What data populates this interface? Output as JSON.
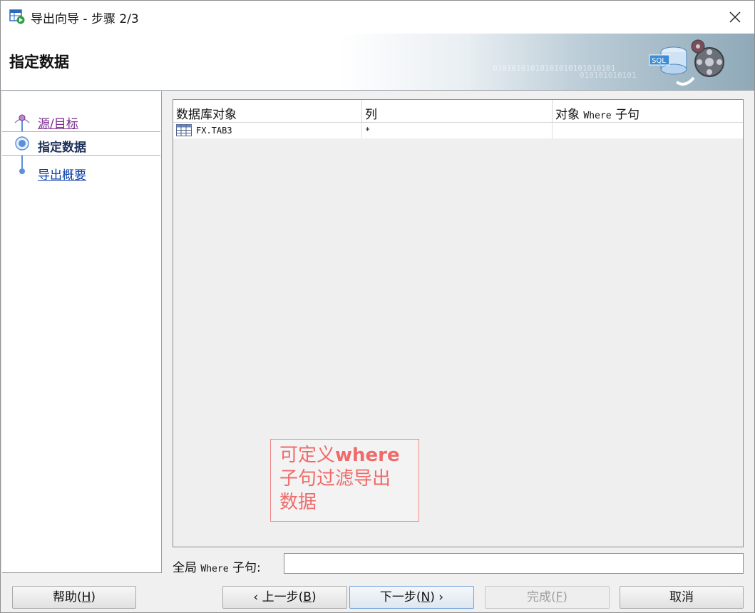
{
  "window": {
    "title": "导出向导 - 步骤 2/3"
  },
  "banner": {
    "title": "指定数据",
    "binary_line1": "01010101010101010101010101",
    "binary_line2": "010101010101"
  },
  "steps": [
    {
      "label": "源/目标",
      "state": "visited"
    },
    {
      "label": "指定数据",
      "state": "current"
    },
    {
      "label": "导出概要",
      "state": "pending"
    }
  ],
  "table": {
    "headers": {
      "col1": "数据库对象",
      "col2": "列",
      "col3_prefix": "对象 ",
      "col3_mono": "Where",
      "col3_suffix": " 子句"
    },
    "rows": [
      {
        "object": "FX.TAB3",
        "columns": "*",
        "where": ""
      }
    ]
  },
  "annotation": {
    "line1_prefix": "可定义",
    "line1_bold": "where",
    "line2": "子句过滤导出",
    "line3": "数据"
  },
  "global_where": {
    "label_prefix": "全局 ",
    "label_mono": "Where",
    "label_suffix": " 子句:",
    "value": ""
  },
  "buttons": {
    "help": {
      "text": "帮助(",
      "key": "H",
      "end": ")"
    },
    "back": {
      "arrow": "‹ ",
      "text": "上一步(",
      "key": "B",
      "end": ")"
    },
    "next": {
      "text": "下一步(",
      "key": "N",
      "end": ")",
      "arrow": " ›"
    },
    "finish": {
      "text": "完成(",
      "key": "F",
      "end": ")"
    },
    "cancel": {
      "text": "取消"
    }
  },
  "colors": {
    "accent": "#5b8fd8",
    "annotation": "#f06a6a",
    "visited_link": "#7b2e8f",
    "link": "#0b3fa8"
  }
}
